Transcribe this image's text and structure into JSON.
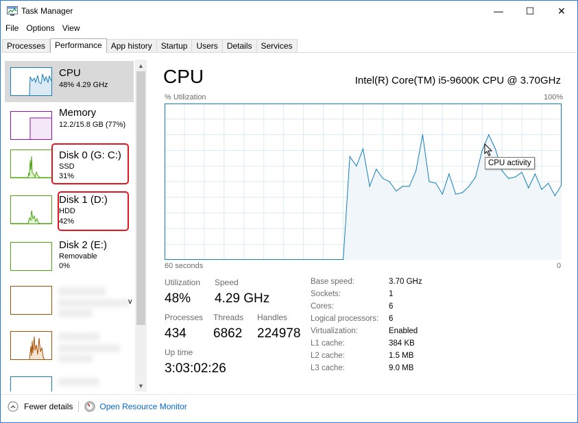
{
  "window": {
    "title": "Task Manager",
    "min_glyph": "—",
    "max_glyph": "☐",
    "close_glyph": "✕"
  },
  "menu": [
    "File",
    "Options",
    "View"
  ],
  "tabs": [
    "Processes",
    "Performance",
    "App history",
    "Startup",
    "Users",
    "Details",
    "Services"
  ],
  "active_tab": "Performance",
  "sidebar": {
    "items": [
      {
        "name": "CPU",
        "sub1": "48% 4.29 GHz",
        "sub2": "",
        "selected": true,
        "color": "#117dbb"
      },
      {
        "name": "Memory",
        "sub1": "12.2/15.8 GB (77%)",
        "sub2": "",
        "color": "#8b12ae"
      },
      {
        "name": "Disk 0 (G: C:)",
        "sub1": "SSD",
        "sub2": "31%",
        "color": "#4da60c"
      },
      {
        "name": "Disk 1 (D:)",
        "sub1": "HDD",
        "sub2": "42%",
        "color": "#4da60c"
      },
      {
        "name": "Disk 2 (E:)",
        "sub1": "Removable",
        "sub2": "0%",
        "color": "#4da60c"
      }
    ],
    "blurred_item_color": "#a74f01",
    "partial_suffix": "v"
  },
  "main": {
    "title": "CPU",
    "model": "Intel(R) Core(TM) i5-9600K CPU @ 3.70GHz",
    "y_label": "% Utilization",
    "y_max_label": "100%",
    "x_left_label": "60 seconds",
    "x_right_label": "0",
    "tooltip": "CPU activity"
  },
  "chart_data": {
    "type": "area",
    "title": "",
    "xlabel": "60 seconds",
    "ylabel": "% Utilization",
    "ylim": [
      0,
      100
    ],
    "xlim": [
      60,
      0
    ],
    "x": [
      60,
      33,
      32,
      31,
      30,
      29,
      28,
      27,
      26,
      25,
      24,
      23,
      22,
      21,
      20,
      19,
      18,
      17,
      16,
      15,
      14,
      13,
      12,
      11,
      10,
      9,
      8,
      7,
      6,
      5,
      4,
      3,
      2,
      1,
      0
    ],
    "values": [
      0,
      0,
      66,
      60,
      71,
      47,
      58,
      52,
      50,
      44,
      47,
      47,
      57,
      80,
      50,
      49,
      42,
      55,
      42,
      43,
      47,
      53,
      70,
      80,
      71,
      57,
      52,
      53,
      56,
      46,
      55,
      45,
      49,
      41,
      48
    ],
    "color": "#117dbb",
    "fill": "#f1f6fa",
    "grid": true
  },
  "stats": {
    "utilization_label": "Utilization",
    "utilization": "48%",
    "speed_label": "Speed",
    "speed": "4.29 GHz",
    "processes_label": "Processes",
    "processes": "434",
    "threads_label": "Threads",
    "threads": "6862",
    "handles_label": "Handles",
    "handles": "224978",
    "uptime_label": "Up time",
    "uptime": "3:03:02:26"
  },
  "details": [
    {
      "label": "Base speed:",
      "value": "3.70 GHz"
    },
    {
      "label": "Sockets:",
      "value": "1"
    },
    {
      "label": "Cores:",
      "value": "6"
    },
    {
      "label": "Logical processors:",
      "value": "6"
    },
    {
      "label": "Virtualization:",
      "value": "Enabled"
    },
    {
      "label": "L1 cache:",
      "value": "384 KB"
    },
    {
      "label": "L2 cache:",
      "value": "1.5 MB"
    },
    {
      "label": "L3 cache:",
      "value": "9.0 MB"
    }
  ],
  "footer": {
    "fewer_details": "Fewer details",
    "open_resource_monitor": "Open Resource Monitor"
  }
}
